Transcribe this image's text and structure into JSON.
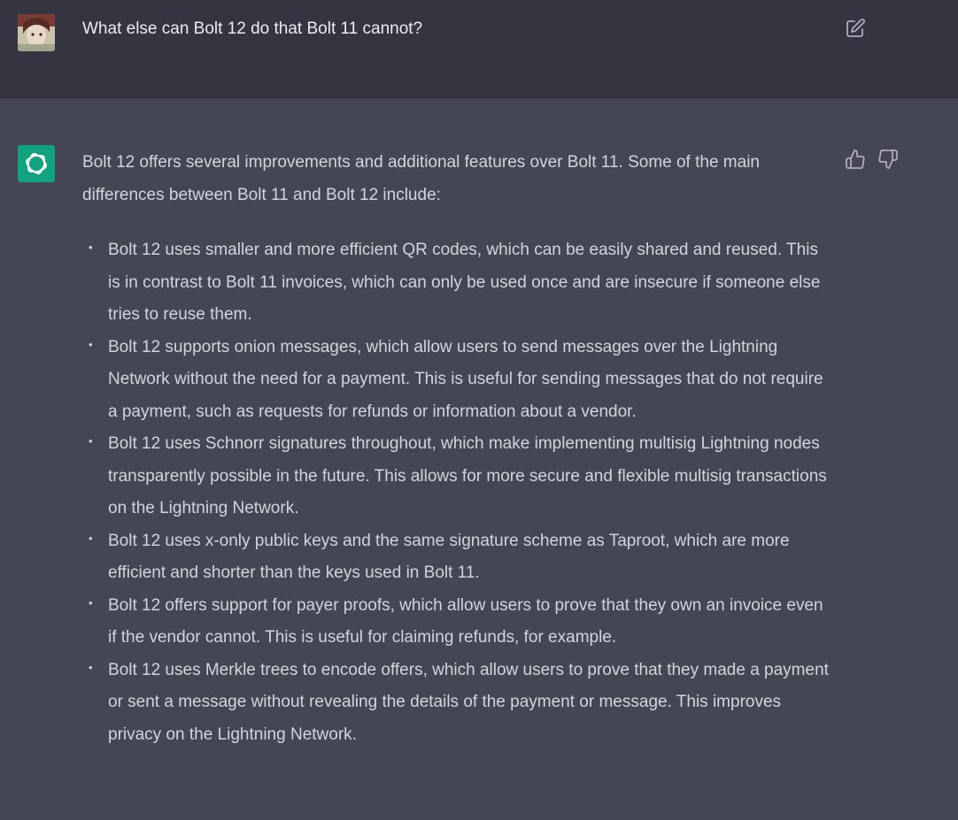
{
  "user_message": {
    "text": "What else can Bolt 12 do that Bolt 11 cannot?",
    "avatar_icon": "user-avatar",
    "edit_icon": "edit-icon"
  },
  "assistant_message": {
    "avatar_icon": "openai-logo-icon",
    "avatar_color": "#10a37f",
    "intro": "Bolt 12 offers several improvements and additional features over Bolt 11. Some of the main differences between Bolt 11 and Bolt 12 include:",
    "bullets": [
      "Bolt 12 uses smaller and more efficient QR codes, which can be easily shared and reused. This is in contrast to Bolt 11 invoices, which can only be used once and are insecure if someone else tries to reuse them.",
      "Bolt 12 supports onion messages, which allow users to send messages over the Lightning Network without the need for a payment. This is useful for sending messages that do not require a payment, such as requests for refunds or information about a vendor.",
      "Bolt 12 uses Schnorr signatures throughout, which make implementing multisig Lightning nodes transparently possible in the future. This allows for more secure and flexible multisig transactions on the Lightning Network.",
      "Bolt 12 uses x-only public keys and the same signature scheme as Taproot, which are more efficient and shorter than the keys used in Bolt 11.",
      "Bolt 12 offers support for payer proofs, which allow users to prove that they own an invoice even if the vendor cannot. This is useful for claiming refunds, for example.",
      "Bolt 12 uses Merkle trees to encode offers, which allow users to prove that they made a payment or sent a message without revealing the details of the payment or message. This improves privacy on the Lightning Network."
    ],
    "thumbs_up_icon": "thumbs-up-icon",
    "thumbs_down_icon": "thumbs-down-icon"
  },
  "colors": {
    "user_bg": "#343541",
    "assistant_bg": "#444654",
    "text": "#d1d5db"
  }
}
